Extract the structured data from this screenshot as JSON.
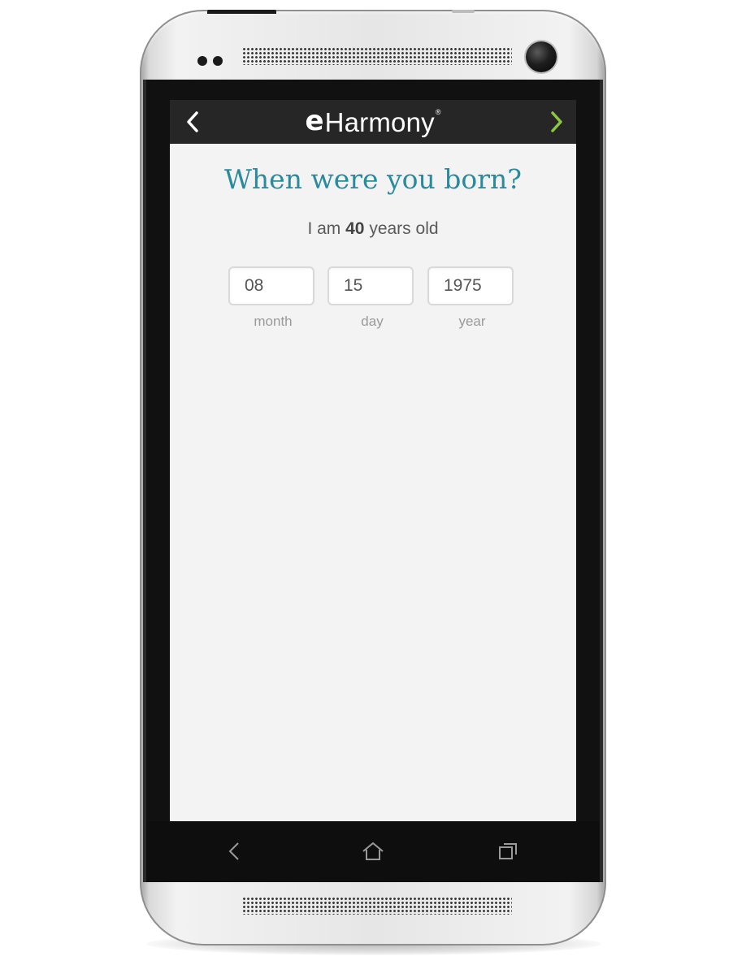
{
  "app": {
    "logo_e": "e",
    "logo_rest": "Harmony",
    "logo_mark": "®",
    "back_icon": "chevron-left-icon",
    "next_icon": "chevron-right-icon",
    "next_color": "#8dc63f"
  },
  "main": {
    "question": "When were you born?",
    "age_prefix": "I am",
    "age_value": "40",
    "age_suffix": "years old"
  },
  "birthdate": {
    "month": {
      "value": "08",
      "label": "month"
    },
    "day": {
      "value": "15",
      "label": "day"
    },
    "year": {
      "value": "1975",
      "label": "year"
    }
  },
  "system_nav": {
    "back_icon": "back-triangle-icon",
    "home_icon": "home-icon",
    "recents_icon": "recent-apps-icon"
  },
  "colors": {
    "header_bg": "#262626",
    "accent_teal": "#2b8a9c",
    "screen_bg": "#f3f3f3"
  }
}
